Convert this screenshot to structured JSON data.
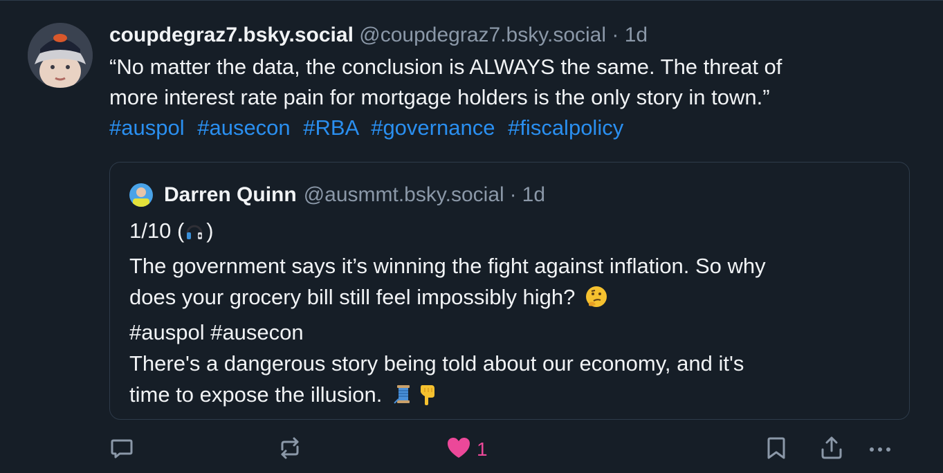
{
  "post": {
    "author_name": "coupdegraz7.bsky.social",
    "author_handle": "@coupdegraz7.bsky.social",
    "separator": "·",
    "timestamp": "1d",
    "text_line1": "“No matter the data, the conclusion is ALWAYS the same. The threat of",
    "text_line2": "more interest rate pain for mortgage holders is the only story in town.”",
    "tags": [
      "#auspol",
      "#ausecon",
      "#RBA",
      "#governance",
      "#fiscalpolicy"
    ]
  },
  "quote": {
    "author_name": "Darren Quinn",
    "author_handle": "@ausmmt.bsky.social",
    "separator": "·",
    "timestamp": "1d",
    "line1": "1/10 (",
    "line1_end": ")",
    "line2": "The government says it’s winning the fight against inflation. So why",
    "line3": "does your grocery bill still feel impossibly high?",
    "line4": "#auspol #ausecon",
    "line5": "There's a dangerous story being told about our economy, and it's",
    "line6": "time to expose the illusion."
  },
  "actions": {
    "like_count": "1",
    "like_color": "#ec4899",
    "icons": [
      "reply-icon",
      "repost-icon",
      "heart-icon",
      "bookmark-icon",
      "share-icon",
      "more-icon"
    ]
  }
}
